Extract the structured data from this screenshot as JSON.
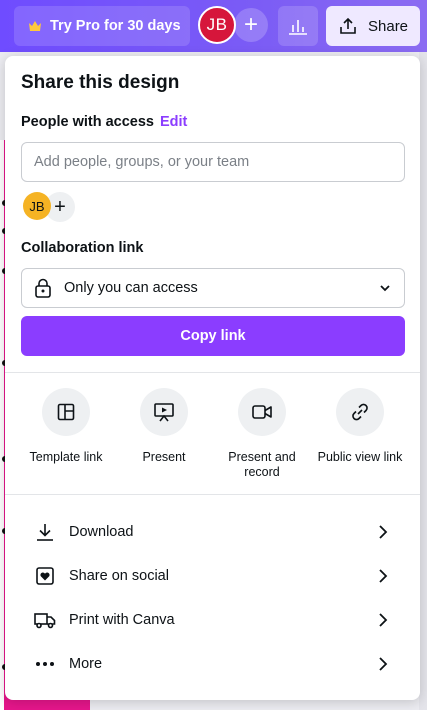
{
  "header": {
    "try_pro_label": "Try Pro for 30 days",
    "avatar_initials": "JB",
    "share_label": "Share"
  },
  "panel": {
    "title": "Share this design",
    "people_label": "People with access",
    "edit_label": "Edit",
    "people_input_placeholder": "Add people, groups, or your team",
    "member_initials": "JB",
    "collab_label": "Collaboration link",
    "access_value": "Only you can access",
    "copy_link_label": "Copy link",
    "options": [
      {
        "label": "Template link",
        "icon": "template-icon"
      },
      {
        "label": "Present",
        "icon": "present-icon"
      },
      {
        "label": "Present and record",
        "icon": "record-icon"
      },
      {
        "label": "Public view link",
        "icon": "link-icon"
      }
    ],
    "rows": [
      {
        "label": "Download",
        "icon": "download-icon"
      },
      {
        "label": "Share on social",
        "icon": "social-icon"
      },
      {
        "label": "Print with Canva",
        "icon": "truck-icon"
      },
      {
        "label": "More",
        "icon": "more-icon"
      }
    ]
  },
  "colors": {
    "accent": "#8b3dff",
    "topbar": "#7b5cf5",
    "avatar_red": "#d6163b",
    "avatar_yellow": "#f5b324",
    "canvas_pink": "#e6168b"
  }
}
